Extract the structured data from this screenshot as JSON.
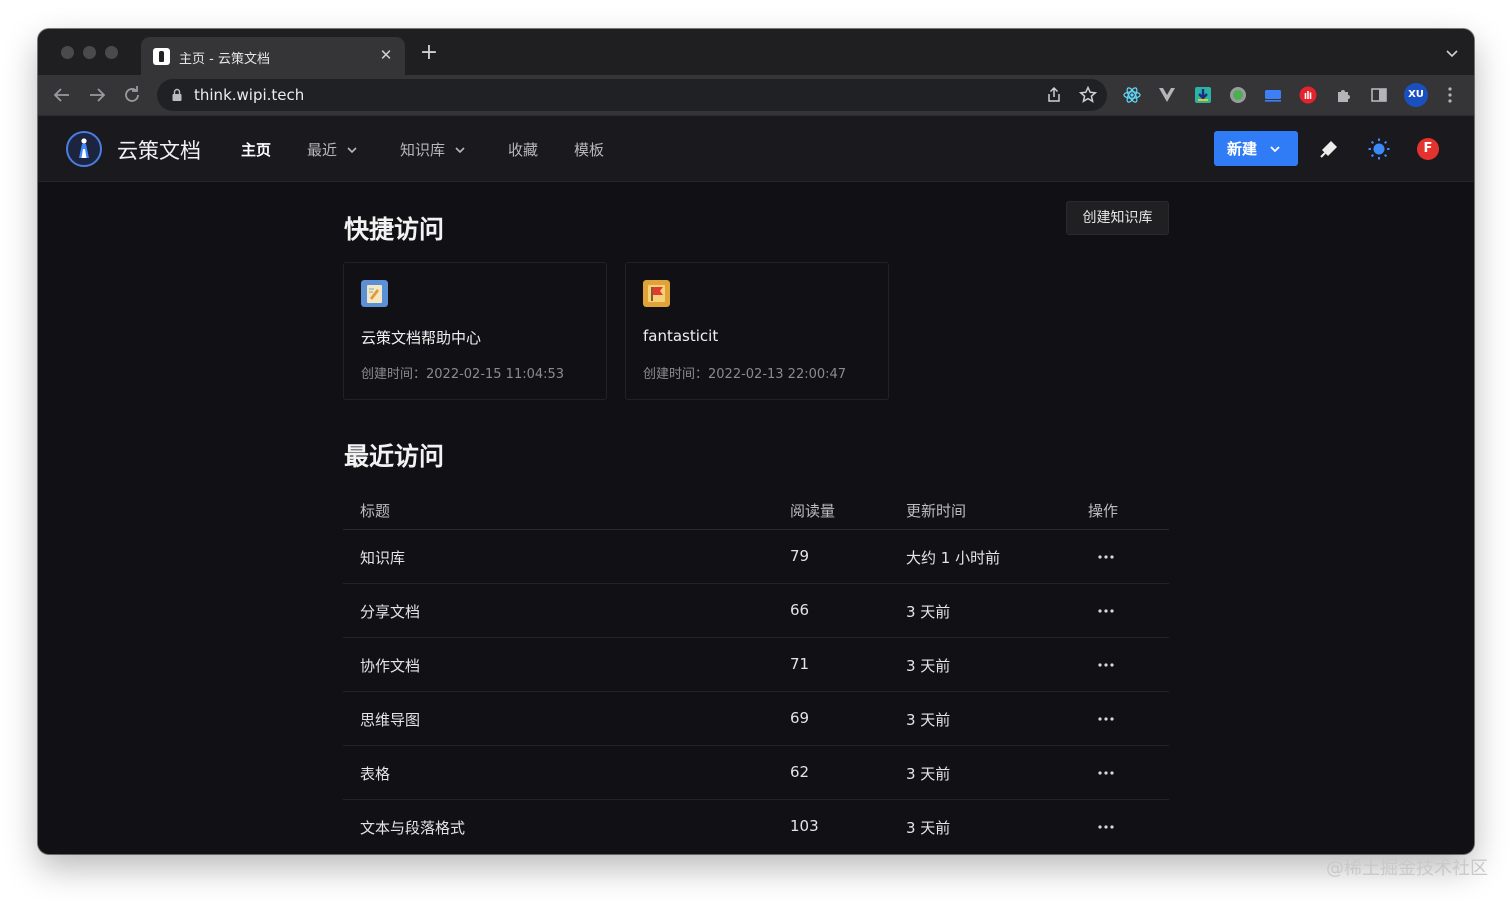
{
  "browser": {
    "tab_title": "主页 - 云策文档",
    "url": "think.wipi.tech",
    "profile_initials": "XU"
  },
  "app": {
    "brand": "云策文档",
    "nav": [
      {
        "label": "主页",
        "active": true
      },
      {
        "label": "最近",
        "dropdown": true
      },
      {
        "label": "知识库",
        "dropdown": true
      },
      {
        "label": "收藏"
      },
      {
        "label": "模板"
      }
    ],
    "new_button": "新建",
    "user_initial": "F",
    "accent_color": "#2f7cf6"
  },
  "quick_access": {
    "title": "快捷访问",
    "create_button": "创建知识库",
    "cards": [
      {
        "name": "云策文档帮助中心",
        "meta": "创建时间：2022-02-15 11:04:53",
        "icon": "notebook-icon"
      },
      {
        "name": "fantasticit",
        "meta": "创建时间：2022-02-13 22:00:47",
        "icon": "flag-book-icon"
      }
    ]
  },
  "recent": {
    "title": "最近访问",
    "columns": [
      "标题",
      "阅读量",
      "更新时间",
      "操作"
    ],
    "rows": [
      {
        "title": "知识库",
        "views": "79",
        "updated": "大约 1 小时前"
      },
      {
        "title": "分享文档",
        "views": "66",
        "updated": "3 天前"
      },
      {
        "title": "协作文档",
        "views": "71",
        "updated": "3 天前"
      },
      {
        "title": "思维导图",
        "views": "69",
        "updated": "3 天前"
      },
      {
        "title": "表格",
        "views": "62",
        "updated": "3 天前"
      },
      {
        "title": "文本与段落格式",
        "views": "103",
        "updated": "3 天前"
      }
    ]
  },
  "watermark": "@稀土掘金技术社区"
}
